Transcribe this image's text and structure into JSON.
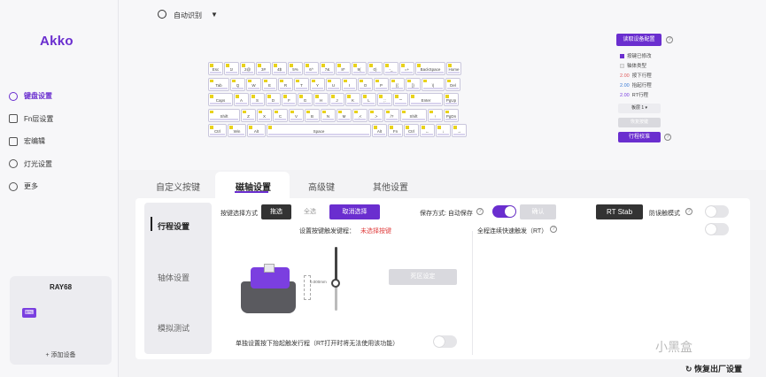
{
  "app": {
    "brand": "Akko"
  },
  "topbar": {
    "language": "自动识别"
  },
  "sidebar": {
    "items": [
      {
        "label": "键盘设置",
        "icon": "gauge-icon",
        "active": true
      },
      {
        "label": "Fn层设置",
        "icon": "fn-icon",
        "active": false
      },
      {
        "label": "宏编辑",
        "icon": "macro-icon",
        "active": false
      },
      {
        "label": "灯光设置",
        "icon": "bulb-icon",
        "active": false
      },
      {
        "label": "更多",
        "icon": "more-icon",
        "active": false
      }
    ],
    "device": {
      "name": "RAY68",
      "add_label": "+ 添加设备"
    }
  },
  "keyboard": {
    "rows": [
      [
        "Esc",
        "1!",
        "2@",
        "3#",
        "4$",
        "5%",
        "6^",
        "7&",
        "8*",
        "9(",
        "0)",
        "-_",
        "=+",
        "BackSpace",
        "Home"
      ],
      [
        "Tab",
        "Q",
        "W",
        "E",
        "R",
        "T",
        "Y",
        "U",
        "I",
        "O",
        "P",
        "[{",
        "]}",
        "\\|",
        "Del"
      ],
      [
        "Caps",
        "A",
        "S",
        "D",
        "F",
        "G",
        "H",
        "J",
        "K",
        "L",
        ";:",
        "'\"",
        "Enter",
        "PgUp"
      ],
      [
        "Shift",
        "Z",
        "X",
        "C",
        "V",
        "B",
        "N",
        "M",
        ",<",
        ".>",
        "/?",
        "Shift",
        "↑",
        "PgDn"
      ],
      [
        "Ctrl",
        "Win",
        "Alt",
        "Space",
        "Alt",
        "Fn",
        "Ctrl",
        "←",
        "↓",
        "→"
      ]
    ]
  },
  "right_panel": {
    "read_config": "读取设备配置",
    "legend": [
      {
        "swatch": "#6a2ecf",
        "label": "按键已修改"
      },
      {
        "swatch": "#e8e8ec",
        "label": "轴体类型"
      },
      {
        "num": "2.00",
        "num_color": "#e05a5a",
        "label": "按下行程"
      },
      {
        "num": "2.00",
        "num_color": "#3a7bd5",
        "label": "抬起行程"
      },
      {
        "num": "2.00",
        "num_color": "#7a3fe0",
        "label": "RT行程"
      }
    ],
    "layer": "板层 1",
    "restore": "恢复按键",
    "calibrate": "行程校准"
  },
  "tabs": [
    {
      "label": "自定义按键",
      "active": false
    },
    {
      "label": "磁轴设置",
      "active": true
    },
    {
      "label": "高级键",
      "active": false
    },
    {
      "label": "其他设置",
      "active": false
    }
  ],
  "subnav": [
    {
      "label": "行程设置",
      "active": true
    },
    {
      "label": "轴体设置",
      "active": false
    },
    {
      "label": "模拟测试",
      "active": false
    }
  ],
  "travel": {
    "select_mode_label": "按键选择方式",
    "pick": "拖选",
    "select_all": "全选",
    "cancel_select": "取消选择",
    "save_mode_label": "保存方式: 自动保存",
    "confirm": "确认",
    "rt_stab": "RT Stab",
    "anti_mistouch": "防误触模式",
    "set_trigger_label": "设置按键触发键程：",
    "no_key_selected": "未选择按键",
    "mm_value": "0.000mm",
    "deadzone": "死区设定",
    "rt_continuous": "全程连续快速触发（RT）",
    "separate_lift": "单独设置按下抬起触发行程（RT打开时将无法使用该功能）"
  },
  "footer": {
    "reset": "恢复出厂设置",
    "watermark": "小黑盒"
  }
}
